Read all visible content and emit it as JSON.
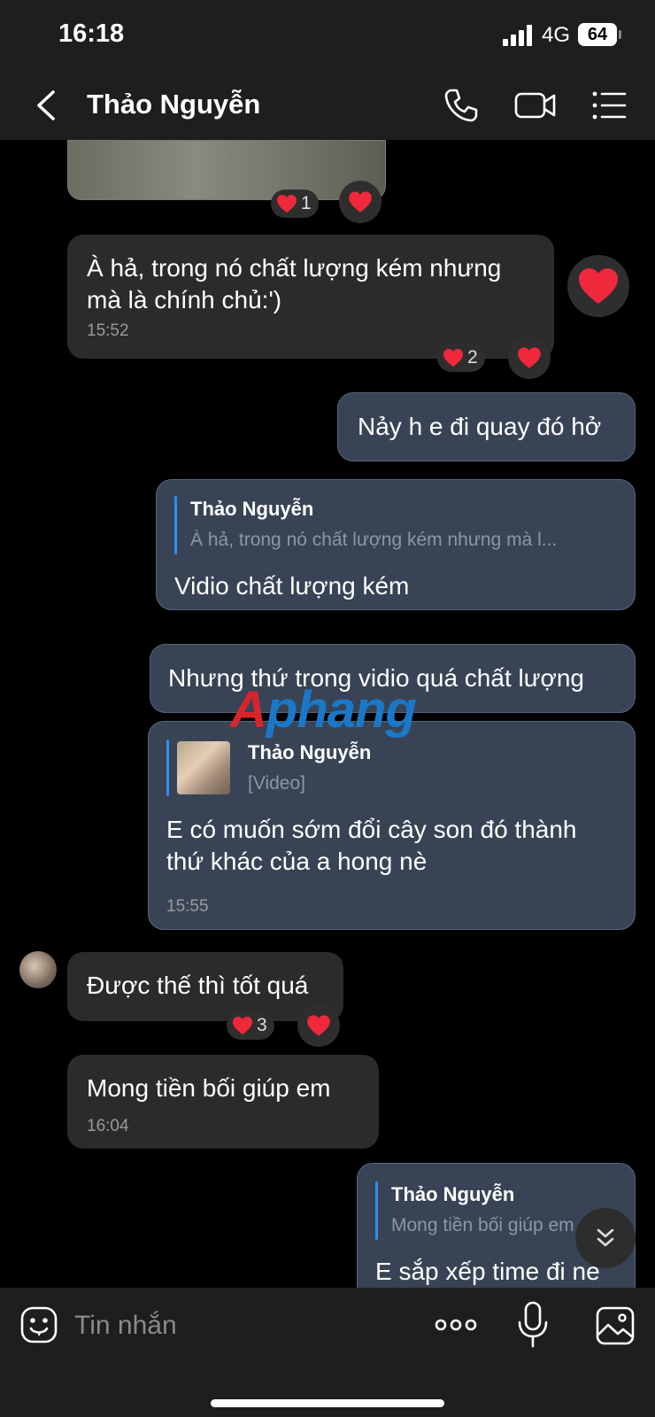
{
  "status": {
    "time": "16:18",
    "network": "4G",
    "battery": "64"
  },
  "header": {
    "title": "Thảo Nguyễn",
    "icons": [
      "back-icon",
      "phone-icon",
      "video-call-icon",
      "menu-list-icon"
    ]
  },
  "messages": {
    "img_msg": {
      "reaction_count": "1"
    },
    "m1": {
      "text": "À hả, trong nó chất lượng kém nhưng mà là chính chủ:')",
      "time": "15:52",
      "reaction_count": "2"
    },
    "m2": {
      "text": "Nảy h e đi quay đó hở"
    },
    "m3": {
      "quote_name": "Thảo Nguyễn",
      "quote_text": "À hả, trong nó chất lượng kém nhưng mà l...",
      "text": "Vidio chất lượng kém"
    },
    "m4": {
      "text": "Nhưng thứ trong vidio quá chất lượng"
    },
    "m5": {
      "quote_name": "Thảo Nguyễn",
      "quote_text": "[Video]",
      "text": "E có muốn sớm đổi cây son đó thành thứ khác của a hong nè",
      "time": "15:55"
    },
    "m6": {
      "text": "Được thế thì tốt quá",
      "reaction_count": "3"
    },
    "m7": {
      "text": "Mong tiền bối giúp em",
      "time": "16:04"
    },
    "m8": {
      "quote_name": "Thảo Nguyễn",
      "quote_text": "Mong tiền bối giúp em",
      "text": "E sắp xếp time đi ne"
    }
  },
  "watermark": {
    "part1": "A",
    "part2": "phang"
  },
  "composer": {
    "placeholder": "Tin nhắn"
  },
  "colors": {
    "accent": "#2f8ef4",
    "heart": "#f0283c",
    "outgoing_bubble": "#384455",
    "incoming_bubble": "#2b2b2b"
  }
}
